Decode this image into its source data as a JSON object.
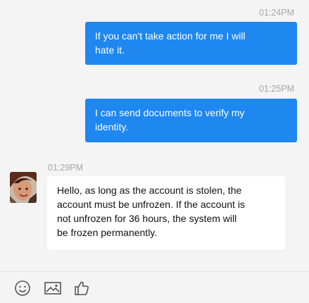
{
  "messages": [
    {
      "direction": "outgoing",
      "time": "01:24PM",
      "text": "If you can't take action for me I will\nhate it."
    },
    {
      "direction": "outgoing",
      "time": "01:25PM",
      "text": "I can send documents to verify my\nidentity."
    },
    {
      "direction": "incoming",
      "time": "01:29PM",
      "text": "Hello, as long as the account is stolen, the\naccount must be unfrozen. If the account is\nnot unfrozen for 36 hours, the system will\nbe frozen permanently."
    }
  ],
  "toolbar": {
    "icons": [
      "emoji-icon",
      "image-icon",
      "thumbs-up-icon"
    ]
  },
  "colors": {
    "outgoing_bubble": "#1e87f0",
    "incoming_bubble": "#ffffff",
    "background": "#f4f4f4",
    "timestamp": "#a7a7a7"
  }
}
